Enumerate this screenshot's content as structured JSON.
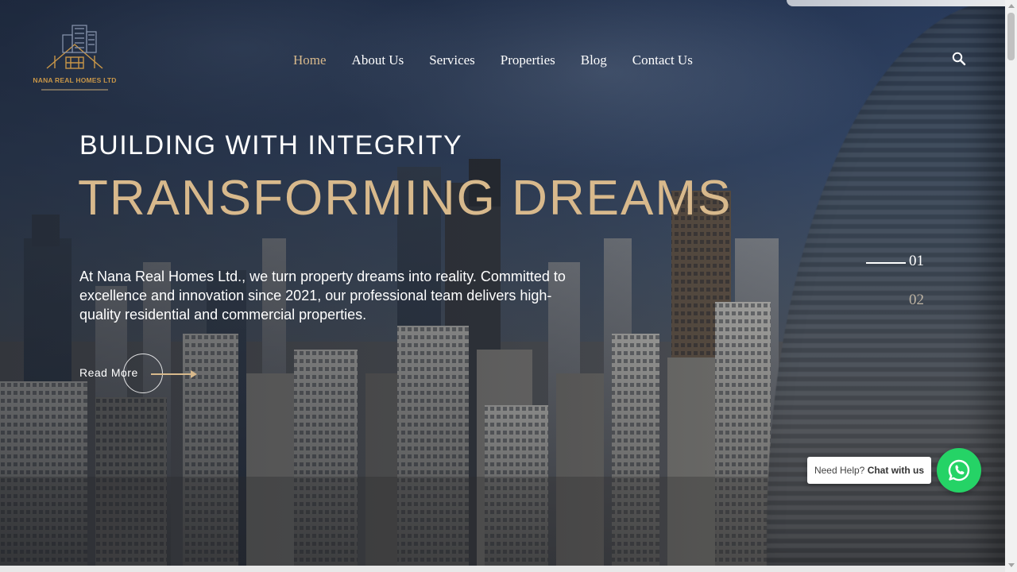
{
  "brand": {
    "logo_text": "NANA REAL HOMES LTD",
    "logo_icon": "building-house-logo"
  },
  "nav": {
    "items": [
      {
        "label": "Home",
        "active": true
      },
      {
        "label": "About Us",
        "active": false
      },
      {
        "label": "Services",
        "active": false
      },
      {
        "label": "Properties",
        "active": false
      },
      {
        "label": "Blog",
        "active": false
      },
      {
        "label": "Contact Us",
        "active": false
      }
    ],
    "search_icon": "search-icon"
  },
  "hero": {
    "eyebrow": "BUILDING WITH INTEGRITY",
    "headline": "TRANSFORMING DREAMS",
    "description": "At Nana Real Homes Ltd., we turn property dreams into reality. Committed to excellence and innovation since 2021, our professional team delivers high-quality residential and commercial properties.",
    "cta_label": "Read More"
  },
  "slider": {
    "slides": [
      {
        "label": "01",
        "active": true
      },
      {
        "label": "02",
        "active": false
      }
    ]
  },
  "chat": {
    "prefix": "Need Help?",
    "action": "Chat with us",
    "icon": "whatsapp-icon"
  },
  "colors": {
    "accent": "#d8b98c",
    "logo_gold": "#c89648",
    "whatsapp_green": "#25d366",
    "text_light": "#ffffff"
  }
}
